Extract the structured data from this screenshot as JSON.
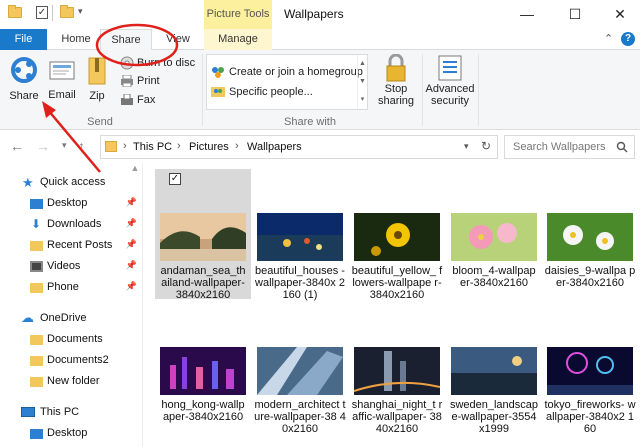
{
  "window": {
    "title": "Wallpapers",
    "context_tab_group": "Picture Tools",
    "minimize_glyph": "—",
    "maximize_glyph": "☐",
    "close_glyph": "✕"
  },
  "ribbon_tabs": [
    "File",
    "Home",
    "Share",
    "View",
    "Manage"
  ],
  "ribbon": {
    "share_label": "Share",
    "email_label": "Email",
    "zip_label": "Zip",
    "burn_label": "Burn to disc",
    "print_label": "Print",
    "fax_label": "Fax",
    "send_group_label": "Send",
    "homegroup_label": "Create or join a homegroup",
    "specific_people_label": "Specific people...",
    "share_with_group_label": "Share with",
    "stop_sharing_label": "Stop\nsharing",
    "advanced_security_label": "Advanced\nsecurity"
  },
  "address": {
    "crumbs": [
      "This PC",
      "Pictures",
      "Wallpapers"
    ],
    "search_placeholder": "Search Wallpapers"
  },
  "nav": {
    "quick_access": "Quick access",
    "items": [
      "Desktop",
      "Downloads",
      "Recent Posts",
      "Videos",
      "Phone"
    ],
    "onedrive": "OneDrive",
    "onedrive_items": [
      "Documents",
      "Documents2",
      "New folder"
    ],
    "this_pc": "This PC",
    "this_pc_items": [
      "Desktop"
    ]
  },
  "files": [
    {
      "name": "andaman_sea_th ailand-wallpaper- 3840x2160",
      "selected": true
    },
    {
      "name": "beautiful_houses -wallpaper-3840x 2160 (1)"
    },
    {
      "name": "beautiful_yellow_ flowers-wallpape r-3840x2160"
    },
    {
      "name": "bloom_4-wallpap er-3840x2160"
    },
    {
      "name": "daisies_9-wallpa per-3840x2160"
    },
    {
      "name": "hong_kong-wallp aper-3840x2160"
    },
    {
      "name": "modern_architect ture-wallpaper-38 40x2160"
    },
    {
      "name": "shanghai_night_t raffic-wallpaper- 3840x2160"
    },
    {
      "name": "sweden_landscap e-wallpaper-3554 x1999"
    },
    {
      "name": "tokyo_fireworks- wallpaper-3840x2 160"
    }
  ],
  "colors": {
    "file_tab": "#1979ca",
    "context_tab": "#fcef9e",
    "annotation": "#e0201b",
    "selection": "#d9d9d9"
  }
}
